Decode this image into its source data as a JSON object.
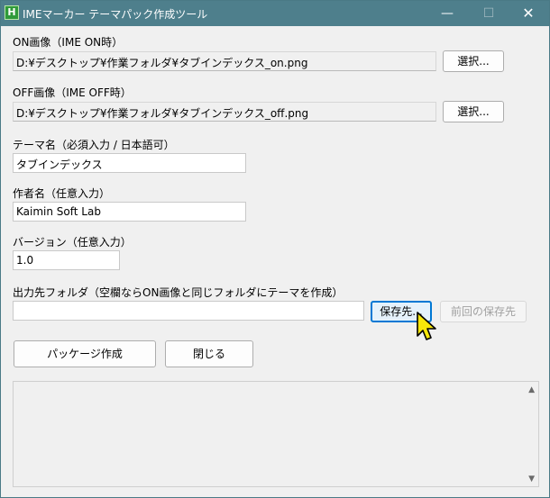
{
  "window": {
    "title": "IMEマーカー テーマパック作成ツール",
    "icon_letter": "H",
    "minimize": "—",
    "maximize": "☐",
    "close": "✕"
  },
  "on_image": {
    "label": "ON画像（IME ON時）",
    "value": "D:¥デスクトップ¥作業フォルダ¥タブインデックス_on.png",
    "button": "選択..."
  },
  "off_image": {
    "label": "OFF画像（IME OFF時）",
    "value": "D:¥デスクトップ¥作業フォルダ¥タブインデックス_off.png",
    "button": "選択..."
  },
  "theme_name": {
    "label": "テーマ名（必須入力 / 日本語可）",
    "value": "タブインデックス"
  },
  "author": {
    "label": "作者名（任意入力）",
    "value": "Kaimin Soft Lab"
  },
  "version": {
    "label": "バージョン（任意入力）",
    "value": "1.0"
  },
  "output": {
    "label": "出力先フォルダ（空欄ならON画像と同じフォルダにテーマを作成）",
    "value": "",
    "save_button": "保存先...",
    "prev_button": "前回の保存先"
  },
  "actions": {
    "create": "パッケージ作成",
    "close": "閉じる"
  },
  "log": {
    "text": "",
    "scroll_up": "▲",
    "scroll_down": "▼"
  }
}
